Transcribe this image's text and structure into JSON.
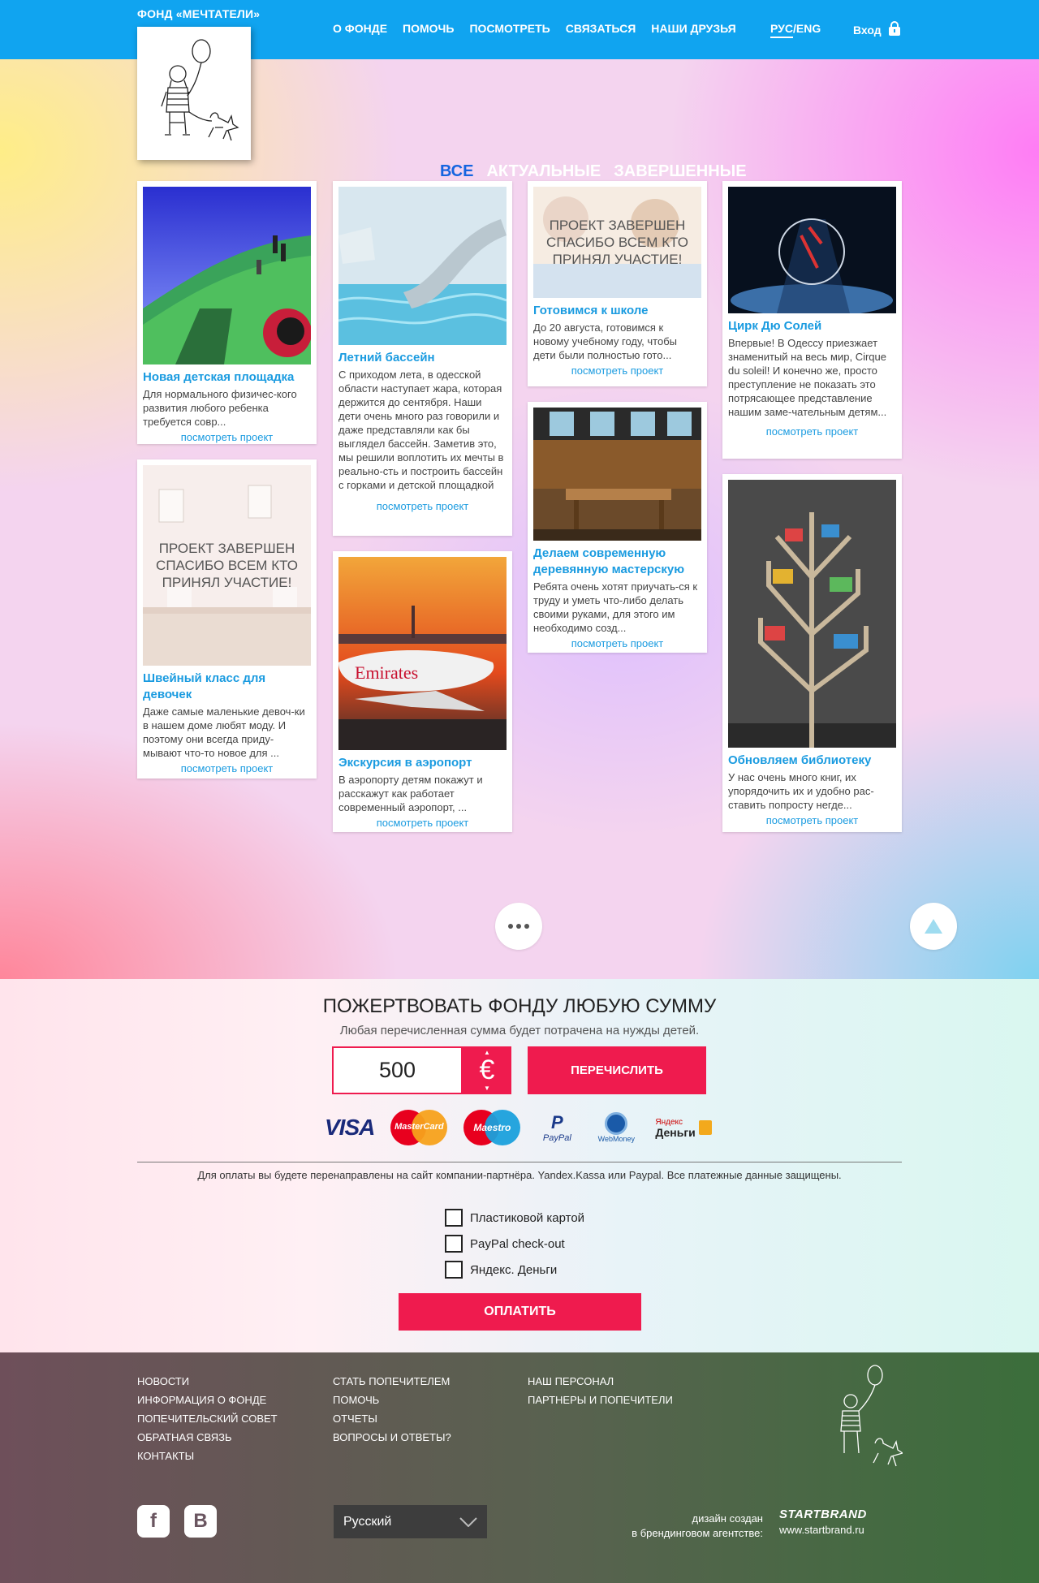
{
  "header": {
    "brand": "ФОНД «МЕЧТАТЕЛИ»",
    "nav": [
      "О ФОНДЕ",
      "ПОМОЧЬ",
      "ПОСМОТРЕТЬ",
      "СВЯЗАТЬСЯ",
      "НАШИ ДРУЗЬЯ"
    ],
    "lang_active": "РУС",
    "lang_sep": "/",
    "lang_other": "ENG",
    "login": "Вход"
  },
  "filters": {
    "all": "ВСЕ",
    "current": "АКТУАЛЬНЫЕ",
    "finished": "ЗАВЕРШЕННЫЕ"
  },
  "cards": [
    {
      "title": "Новая детская площадка",
      "desc": "Для нормального физичес-кого развития любого ребенка требуется совр...",
      "more": "посмотреть проект"
    },
    {
      "title": "Швейный класс для девочек",
      "desc": "Даже самые маленькие девоч-ки в нашем доме любят моду. И поэтому они всегда приду-мывают что-то новое для ...",
      "more": "посмотреть проект",
      "overlay": "ПРОЕКТ ЗАВЕРШЕН СПАСИБО ВСЕМ КТО ПРИНЯЛ УЧАСТИЕ!"
    },
    {
      "title": "Летний бассейн",
      "desc": "С приходом лета, в одесской области наступает жара, которая держится до сентября. Наши дети очень много раз говорили и даже представляли как бы выглядел бассейн. Заметив это, мы решили воплотить их мечты в реально-сть и построить бассейн с горками и детской площадкой",
      "more": "посмотреть проект"
    },
    {
      "title": "Экскурсия в аэропорт",
      "desc": "В аэропорту детям покажут и расскажут как работает современный аэропорт, ...",
      "more": "посмотреть проект",
      "plane_text": "Emirates"
    },
    {
      "title": "Готовимся к школе",
      "desc": "До 20 августа, готовимся к новому учебному году, чтобы дети были полностью гото...",
      "more": "посмотреть проект",
      "overlay": "ПРОЕКТ ЗАВЕРШЕН СПАСИБО ВСЕМ КТО ПРИНЯЛ УЧАСТИЕ!"
    },
    {
      "title": "Делаем современную деревянную мастерскую",
      "desc": "Ребята очень хотят приучать-ся к труду и уметь что-либо делать своими руками, для этого им необходимо созд...",
      "more": "посмотреть проект"
    },
    {
      "title": "Цирк Дю Солей",
      "desc": "Впервые! В Одессу приезжает знаменитый на весь мир, Cirque du soleil! И конечно же, просто преступление не показать это потрясающее представление нашим заме-чательным детям...",
      "more": "посмотреть проект"
    },
    {
      "title": "Обновляем библиотеку",
      "desc": "У нас очень много книг, их упорядочить их и удобно рас-ставить попросту негде...",
      "more": "посмотреть проект"
    }
  ],
  "donate": {
    "title": "ПОЖЕРТВОВАТЬ ФОНДУ ЛЮБУЮ СУММУ",
    "subtitle": "Любая перечисленная сумма будет потрачена на нужды детей.",
    "amount": "500",
    "currency": "€",
    "transfer": "ПЕРЕЧИСЛИТЬ",
    "logos": {
      "visa": "VISA",
      "mastercard": "MasterCard",
      "maestro": "Maestro",
      "paypal": "PayPal",
      "webmoney": "WebMoney",
      "yandex_top": "Яндекс",
      "yandex_bottom": "Деньги"
    },
    "note": "Для оплаты вы будете перенаправлены на сайт компании-партнёра. Yandex.Kassa или Paypal. Все платежные данные защищены.",
    "options": [
      "Пластиковой картой",
      "PayPal check-out",
      "Яндекс. Деньги"
    ],
    "pay": "ОПЛАТИТЬ"
  },
  "footer": {
    "col1": [
      "НОВОСТИ",
      "ИНФОРМАЦИЯ О ФОНДЕ",
      "ПОПЕЧИТЕЛЬСКИЙ СОВЕТ",
      "ОБРАТНАЯ СВЯЗЬ",
      "КОНТАКТЫ"
    ],
    "col2": [
      "СТАТЬ ПОПЕЧИТЕЛЕМ",
      "ПОМОЧЬ",
      "ОТЧЕТЫ",
      "ВОПРОСЫ И ОТВЕТЫ?"
    ],
    "col3": [
      "НАШ ПЕРСОНАЛ",
      "ПАРТНЕРЫ И ПОПЕЧИТЕЛИ"
    ],
    "facebook": "f",
    "vk": "B",
    "language": "Русский",
    "credits_line1": "дизайн создан",
    "credits_line2": "в брендинговом агентстве:",
    "agency": "STARTBRAND",
    "agency_url": "www.startbrand.ru"
  },
  "colors": {
    "header_blue": "#10a4f0",
    "accent_red": "#ef1b4e",
    "link_blue": "#1a9be0",
    "filter_active": "#1565e0"
  },
  "icons": [
    "lock-icon",
    "more-dots-icon",
    "scroll-up-icon",
    "facebook-icon",
    "vk-icon",
    "chevron-down-icon",
    "euro-icon"
  ]
}
